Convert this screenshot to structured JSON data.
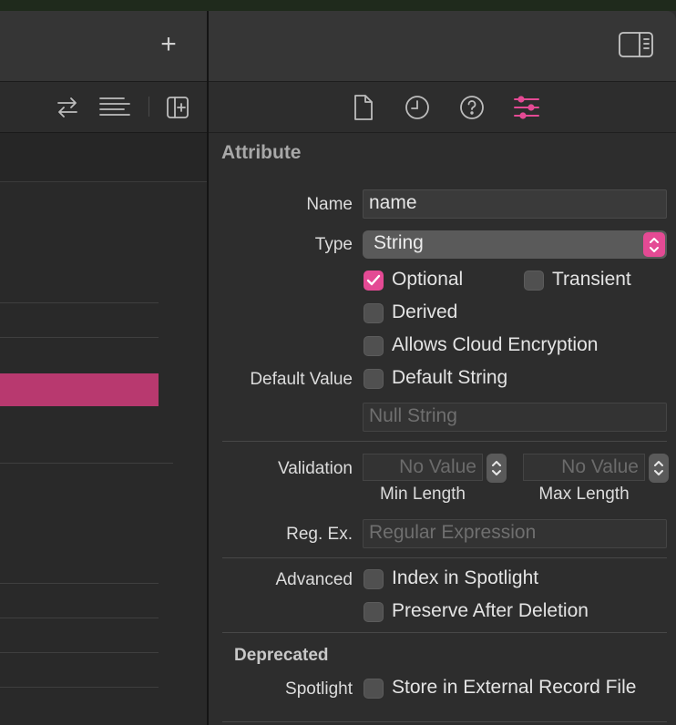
{
  "inspector": {
    "section_title": "Attribute",
    "name_label": "Name",
    "name_value": "name",
    "type_label": "Type",
    "type_value": "String",
    "optional_label": "Optional",
    "optional_checked": true,
    "transient_label": "Transient",
    "derived_label": "Derived",
    "cloud_label": "Allows Cloud Encryption",
    "default_value_label": "Default Value",
    "default_string_label": "Default String",
    "null_string_placeholder": "Null String",
    "validation_label": "Validation",
    "min_placeholder": "No Value",
    "max_placeholder": "No Value",
    "min_caption": "Min Length",
    "max_caption": "Max Length",
    "regex_label": "Reg. Ex.",
    "regex_placeholder": "Regular Expression",
    "advanced_label": "Advanced",
    "index_spotlight_label": "Index in Spotlight",
    "preserve_label": "Preserve After Deletion",
    "deprecated_title": "Deprecated",
    "spotlight_label": "Spotlight",
    "external_record_label": "Store in External Record File"
  },
  "toolbar": {
    "add_icon": "plus-icon",
    "tab_icons": [
      "file-icon",
      "clock-icon",
      "help-icon",
      "sliders-icon"
    ],
    "active_tab": "sliders-icon"
  },
  "colors": {
    "accent": "#e44a94",
    "selection": "#b8396f"
  }
}
